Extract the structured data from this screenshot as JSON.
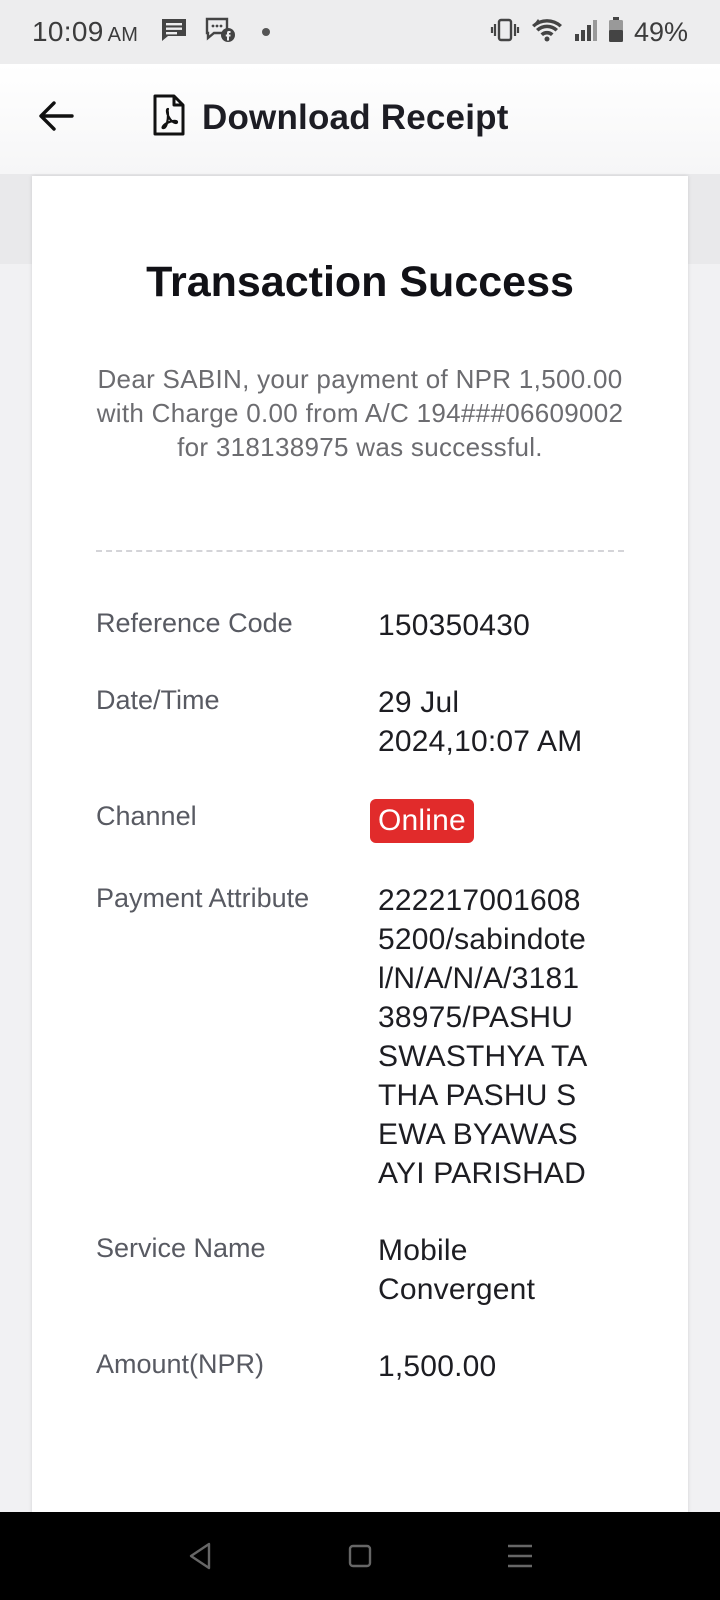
{
  "status_bar": {
    "time": "10:09",
    "ampm": "AM",
    "battery": "49%"
  },
  "header": {
    "title": "Download Receipt"
  },
  "receipt": {
    "title": "Transaction Success",
    "message": "Dear SABIN, your payment of NPR 1,500.00 with Charge 0.00 from A/C 194###06609002 for 318138975 was successful.",
    "rows": [
      {
        "label": "Reference Code",
        "value": "150350430"
      },
      {
        "label": "Date/Time",
        "value": "29 Jul 2024,10:07 AM"
      },
      {
        "label": "Channel",
        "value": "Online"
      },
      {
        "label": "Payment Attribute",
        "value": "2222170016085200/sabindotel/N/A/N/A/318138975/PASHU SWASTHYA TATHA PASHU SEWA BYAWASAYI PARISHAD"
      },
      {
        "label": "Service Name",
        "value": "Mobile Convergent"
      },
      {
        "label": "Amount(NPR)",
        "value": "1,500.00"
      }
    ]
  },
  "colors": {
    "badge": "#e12b2b",
    "title": "#111116"
  }
}
